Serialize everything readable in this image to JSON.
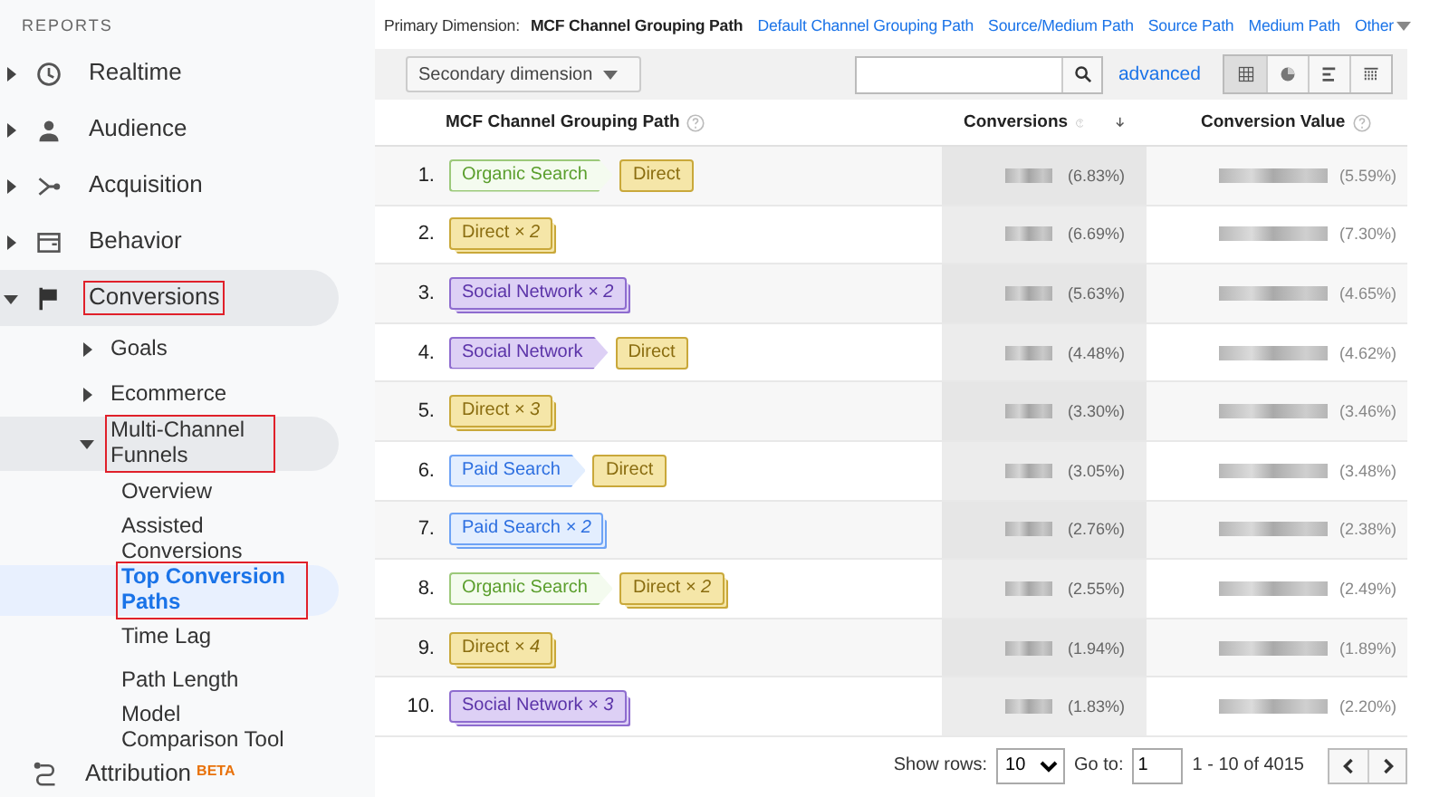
{
  "sidebar": {
    "heading": "REPORTS",
    "items": [
      {
        "label": "Realtime",
        "expanded": false,
        "selected": false,
        "highlighted": false
      },
      {
        "label": "Audience",
        "expanded": false,
        "selected": false,
        "highlighted": false
      },
      {
        "label": "Acquisition",
        "expanded": false,
        "selected": false,
        "highlighted": false
      },
      {
        "label": "Behavior",
        "expanded": false,
        "selected": false,
        "highlighted": false
      },
      {
        "label": "Conversions",
        "expanded": true,
        "selected": false,
        "highlighted": true,
        "children": [
          {
            "label": "Goals",
            "expanded": false,
            "selected": false,
            "highlighted": false
          },
          {
            "label": "Ecommerce",
            "expanded": false,
            "selected": false,
            "highlighted": false
          },
          {
            "label": "Multi-Channel Funnels",
            "expanded": true,
            "selected": false,
            "highlighted": true,
            "children": [
              {
                "label": "Overview",
                "selected": false,
                "highlighted": false
              },
              {
                "label": "Assisted Conversions",
                "selected": false,
                "highlighted": false
              },
              {
                "label": "Top Conversion Paths",
                "selected": true,
                "highlighted": true
              },
              {
                "label": "Time Lag",
                "selected": false,
                "highlighted": false
              },
              {
                "label": "Path Length",
                "selected": false,
                "highlighted": false
              },
              {
                "label": "Model Comparison Tool",
                "selected": false,
                "highlighted": false
              }
            ]
          }
        ]
      },
      {
        "label": "Attribution",
        "badge": "BETA",
        "selected": false,
        "highlighted": false
      }
    ]
  },
  "dimensions": {
    "label": "Primary Dimension:",
    "options": [
      {
        "label": "MCF Channel Grouping Path",
        "selected": true
      },
      {
        "label": "Default Channel Grouping Path",
        "selected": false
      },
      {
        "label": "Source/Medium Path",
        "selected": false
      },
      {
        "label": "Source Path",
        "selected": false
      },
      {
        "label": "Medium Path",
        "selected": false
      },
      {
        "label": "Other",
        "selected": false,
        "dropdown": true
      }
    ]
  },
  "toolbar": {
    "secondary_dimension": "Secondary dimension",
    "advanced": "advanced",
    "views": [
      {
        "selected": true
      },
      {
        "selected": false
      },
      {
        "selected": false
      },
      {
        "selected": false
      }
    ]
  },
  "table": {
    "columns": [
      "MCF Channel Grouping Path",
      "Conversions",
      "Conversion Value"
    ],
    "rows": [
      {
        "rank": "1.",
        "path": [
          {
            "kind": "organic",
            "label": "Organic Search",
            "stacked": false
          },
          {
            "kind": "direct",
            "label": "Direct",
            "stacked": false
          }
        ],
        "conversions_pct": "(6.83%)",
        "value_pct": "(5.59%)"
      },
      {
        "rank": "2.",
        "path": [
          {
            "kind": "direct",
            "label": "Direct *× 2*",
            "stacked": true
          }
        ],
        "conversions_pct": "(6.69%)",
        "value_pct": "(7.30%)"
      },
      {
        "rank": "3.",
        "path": [
          {
            "kind": "social",
            "label": "Social Network *× 2*",
            "stacked": true
          }
        ],
        "conversions_pct": "(5.63%)",
        "value_pct": "(4.65%)"
      },
      {
        "rank": "4.",
        "path": [
          {
            "kind": "social",
            "label": "Social Network",
            "stacked": false
          },
          {
            "kind": "direct",
            "label": "Direct",
            "stacked": false
          }
        ],
        "conversions_pct": "(4.48%)",
        "value_pct": "(4.62%)"
      },
      {
        "rank": "5.",
        "path": [
          {
            "kind": "direct",
            "label": "Direct *× 3*",
            "stacked": true
          }
        ],
        "conversions_pct": "(3.30%)",
        "value_pct": "(3.46%)"
      },
      {
        "rank": "6.",
        "path": [
          {
            "kind": "paid",
            "label": "Paid Search",
            "stacked": false
          },
          {
            "kind": "direct",
            "label": "Direct",
            "stacked": false
          }
        ],
        "conversions_pct": "(3.05%)",
        "value_pct": "(3.48%)"
      },
      {
        "rank": "7.",
        "path": [
          {
            "kind": "paid",
            "label": "Paid Search *× 2*",
            "stacked": true
          }
        ],
        "conversions_pct": "(2.76%)",
        "value_pct": "(2.38%)"
      },
      {
        "rank": "8.",
        "path": [
          {
            "kind": "organic",
            "label": "Organic Search",
            "stacked": false
          },
          {
            "kind": "direct",
            "label": "Direct *× 2*",
            "stacked": true
          }
        ],
        "conversions_pct": "(2.55%)",
        "value_pct": "(2.49%)"
      },
      {
        "rank": "9.",
        "path": [
          {
            "kind": "direct",
            "label": "Direct *× 4*",
            "stacked": true
          }
        ],
        "conversions_pct": "(1.94%)",
        "value_pct": "(1.89%)"
      },
      {
        "rank": "10.",
        "path": [
          {
            "kind": "social",
            "label": "Social Network *× 3*",
            "stacked": true
          }
        ],
        "conversions_pct": "(1.83%)",
        "value_pct": "(2.20%)"
      }
    ]
  },
  "pagination": {
    "show_rows_label": "Show rows:",
    "rows_value": "10",
    "goto_label": "Go to:",
    "goto_value": "1",
    "range": "1 - 10 of 4015"
  }
}
